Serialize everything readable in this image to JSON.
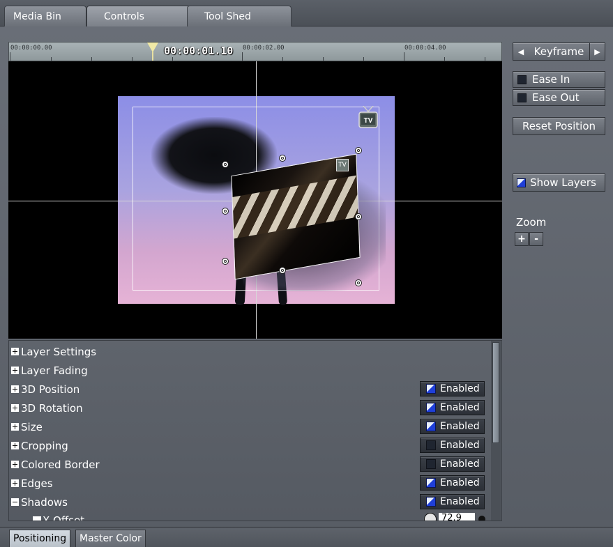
{
  "tabs": {
    "items": [
      {
        "label": "Media Bin",
        "active": false
      },
      {
        "label": "Controls",
        "active": true
      },
      {
        "label": "Tool Shed",
        "active": false
      }
    ]
  },
  "timeline": {
    "start_label": "00:00:00.00",
    "mid_label": "00:00:02.00",
    "end_label": "00:00:04.00",
    "current_time": "00:00:01.10"
  },
  "viewport": {
    "logo_text": "TV"
  },
  "keyframe": {
    "label": "Keyframe",
    "prev_icon": "triangle-left-icon",
    "next_icon": "triangle-right-icon"
  },
  "ease": {
    "in_label": "Ease In",
    "in_checked": false,
    "out_label": "Ease Out",
    "out_checked": false
  },
  "reset_label": "Reset Position",
  "show_layers": {
    "label": "Show Layers",
    "checked": true
  },
  "zoom": {
    "label": "Zoom",
    "plus": "+",
    "minus": "-"
  },
  "properties": {
    "enabled_label": "Enabled",
    "rows": [
      {
        "label": "Layer Settings",
        "expanded": false
      },
      {
        "label": "Layer Fading",
        "expanded": false
      },
      {
        "label": "3D Position",
        "expanded": false,
        "enabled": true
      },
      {
        "label": "3D Rotation",
        "expanded": false,
        "enabled": true
      },
      {
        "label": "Size",
        "expanded": false,
        "enabled": true
      },
      {
        "label": "Cropping",
        "expanded": false,
        "enabled": false
      },
      {
        "label": "Colored Border",
        "expanded": false,
        "enabled": false
      },
      {
        "label": "Edges",
        "expanded": false,
        "enabled": true
      },
      {
        "label": "Shadows",
        "expanded": true,
        "enabled": true
      }
    ],
    "sub_row": {
      "label": "X Offset",
      "value": "72.9"
    }
  },
  "bottom_tabs": {
    "items": [
      {
        "label": "Positioning",
        "active": true
      },
      {
        "label": "Master Color",
        "active": false
      }
    ]
  },
  "colors": {
    "checkbox_on": "#1f3fd8",
    "panel_bg": "#5f646c",
    "viewport_bg": "#000000",
    "playhead": "#f0e9a6"
  }
}
